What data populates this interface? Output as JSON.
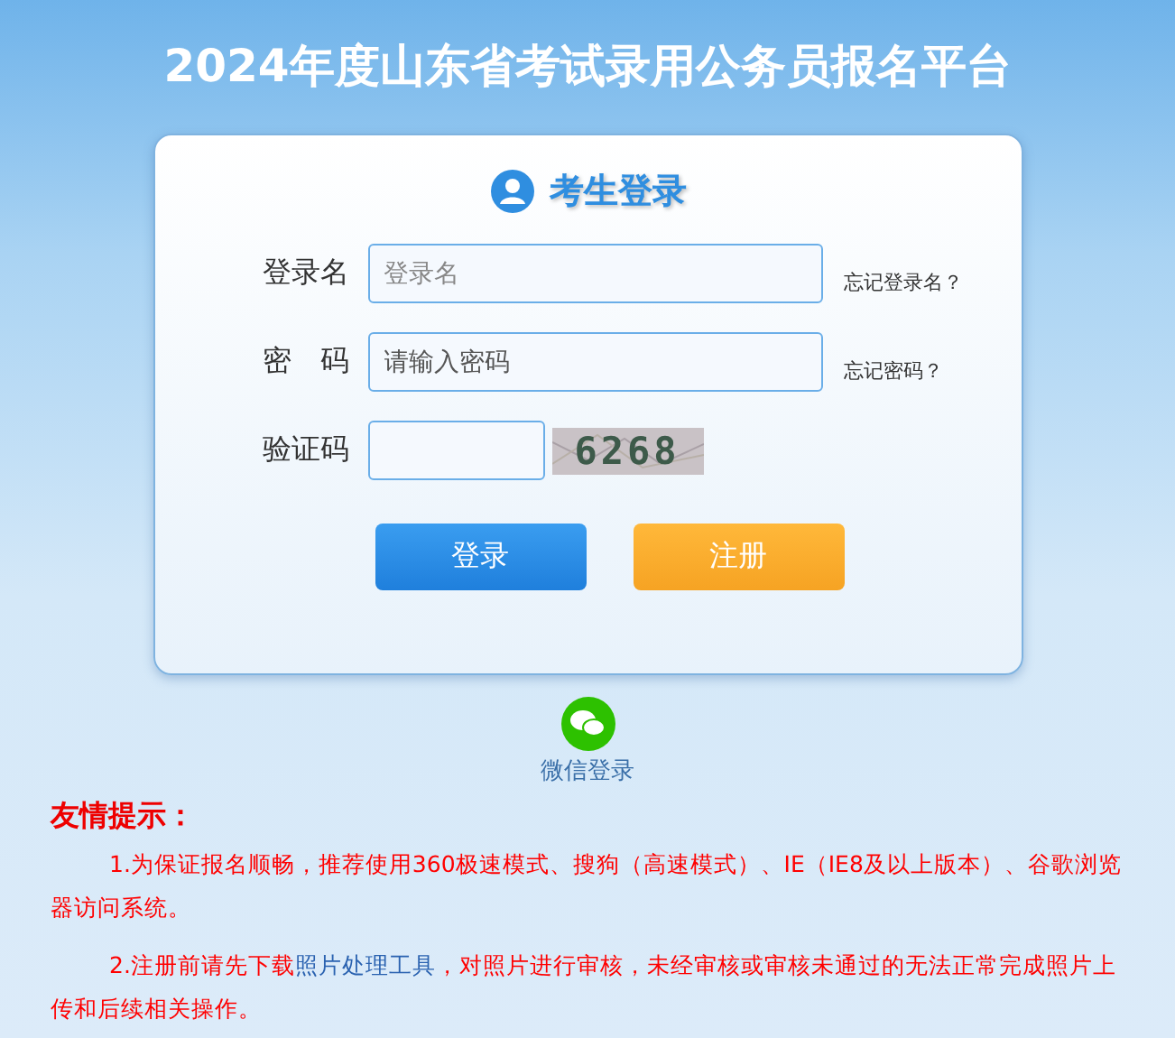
{
  "page_title": "2024年度山东省考试录用公务员报名平台",
  "login": {
    "heading": "考生登录",
    "fields": [
      {
        "label": "登录名",
        "placeholder": "登录名",
        "link": "忘记登录名？"
      },
      {
        "label": "密　码",
        "value": "请输入密码",
        "link": "忘记密码？"
      }
    ],
    "captcha": {
      "label": "验证码",
      "code": "6268"
    },
    "buttons": [
      {
        "label": "登录",
        "kind": "primary"
      },
      {
        "label": "注册",
        "kind": "secondary"
      }
    ]
  },
  "wechat_login": "微信登录",
  "notice": {
    "title": "友情提示：",
    "items": [
      {
        "text": "1.为保证报名顺畅，推荐使用360极速模式、搜狗（高速模式）、IE（IE8及以上版本）、谷歌浏览器访问系统。"
      },
      {
        "before": "2.注册前请先下载",
        "link": "照片处理工具",
        "after": "，对照片进行审核，未经审核或审核未通过的无法正常完成照片上传和后续相关操作。"
      }
    ]
  }
}
